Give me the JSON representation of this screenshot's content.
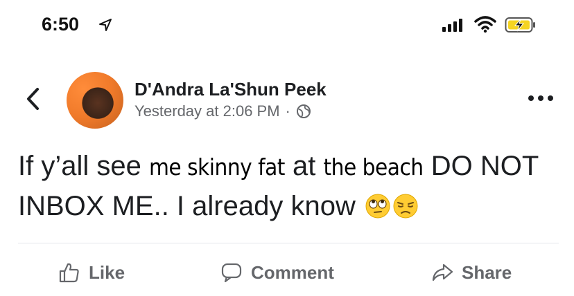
{
  "status_bar": {
    "time": "6:50",
    "icons": [
      "location-arrow-icon",
      "cellular-signal-icon",
      "wifi-icon",
      "battery-charging-icon"
    ]
  },
  "post": {
    "author": "D'Andra La'Shun Peek",
    "timestamp": "Yesterday at 2:06 PM",
    "separator": "·",
    "privacy_icon": "globe-icon",
    "text_parts": {
      "p1": "If y’all see ",
      "p2": "me skinny fat",
      "p3": "  at ",
      "p4": "the beach",
      "p5": " DO NOT INBOX ME.. I already know"
    },
    "emojis": [
      "face-with-rolling-eyes",
      "unamused-face"
    ]
  },
  "actions": {
    "like": "Like",
    "comment": "Comment",
    "share": "Share"
  },
  "colors": {
    "text": "#1c1e21",
    "secondary": "#65676b",
    "divider": "#e4e6eb",
    "emoji": "#ffcc33"
  }
}
